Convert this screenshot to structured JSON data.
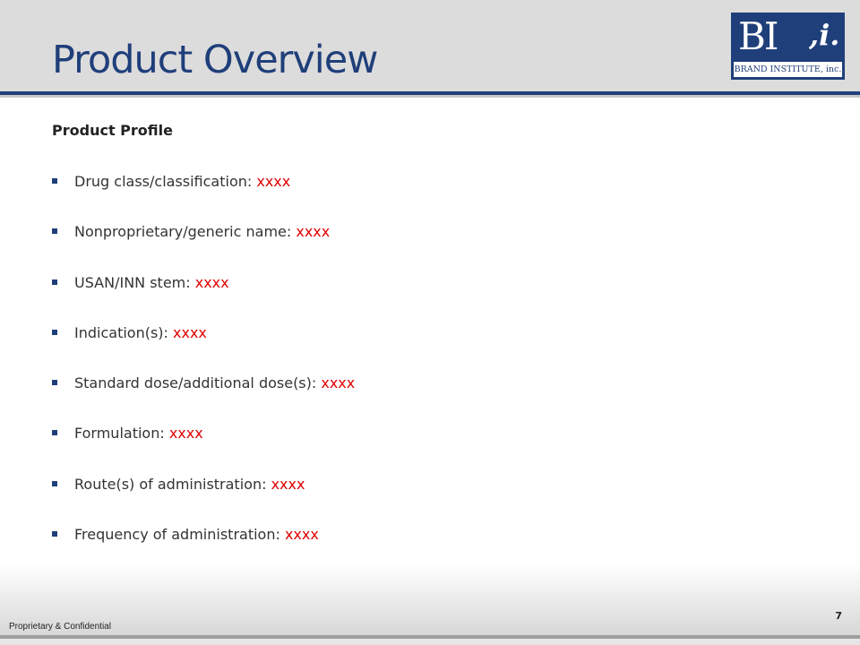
{
  "slide": {
    "title": "Product Overview",
    "subtitle": "Product Profile",
    "logo": {
      "mark": "BI",
      "suffix": ",i.",
      "name": "BRAND INSTITUTE, inc."
    },
    "items": [
      {
        "label": "Drug class/classification: ",
        "value": "xxxx"
      },
      {
        "label": "Nonproprietary/generic  name: ",
        "value": "xxxx"
      },
      {
        "label": "USAN/INN stem: ",
        "value": "xxxx"
      },
      {
        "label": "Indication(s): ",
        "value": "xxxx"
      },
      {
        "label": "Standard dose/additional dose(s): ",
        "value": "xxxx"
      },
      {
        "label": "Formulation: ",
        "value": "xxxx"
      },
      {
        "label": "Route(s) of administration: ",
        "value": "xxxx"
      },
      {
        "label": "Frequency of administration: ",
        "value": "xxxx"
      }
    ],
    "footer": "Proprietary & Confidential",
    "page_number": "7"
  },
  "colors": {
    "brand_navy": "#1f3f7a",
    "placeholder_red": "#e00000"
  }
}
